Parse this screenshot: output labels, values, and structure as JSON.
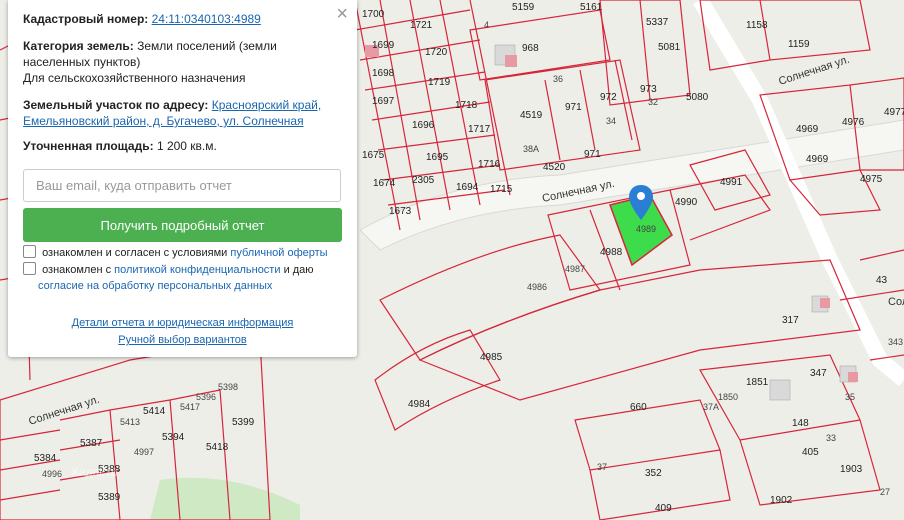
{
  "panel": {
    "close_symbol": "×",
    "cadastral_label": "Кадастровый номер:",
    "cadastral_value": "24:11:0340103:4989",
    "category_label": "Категория земель:",
    "category_value_1": "Земли поселений (земли",
    "category_value_2": "населенных пунктов)",
    "category_value_3": "Для сельскохозяйственного назначения",
    "address_label": "Земельный участок по адресу:",
    "address_value_1": "Красноярский край,",
    "address_value_2": "Емельяновский район, д. Бугачево, ул. Солнечная",
    "area_label": "Уточненная площадь:",
    "area_value": "1 200 кв.м.",
    "email_placeholder": "Ваш email, куда отправить отчет",
    "submit_label": "Получить подробный отчет",
    "consent1_text": "ознакомлен и согласен с условиями",
    "consent1_link": "публичной оферты",
    "consent2_text": "ознакомлен с",
    "consent2_link": "политикой конфиденциальности",
    "consent2_text2": "и даю",
    "consent2_link2": "согласие на обработку персональных данных",
    "details_link": "Детали отчета и юридическая информация",
    "manual_link": "Ручной выбор вариантов"
  },
  "map": {
    "streets": [
      "Солнечная ул.",
      "Солнечная ул.",
      "Солнечная ул.",
      "Солнечная ул."
    ],
    "selected_parcel": "4989",
    "parcels": [
      "1700",
      "1721",
      "1699",
      "1720",
      "1698",
      "1719",
      "1697",
      "1718",
      "1696",
      "1717",
      "1695",
      "1716",
      "1694",
      "1715",
      "1675",
      "1674",
      "1673",
      "2305",
      "4",
      "5159",
      "5161",
      "968",
      "5337",
      "5081",
      "1158",
      "1159",
      "36",
      "32",
      "34",
      "4519",
      "971",
      "972",
      "973",
      "5080",
      "4520",
      "38A",
      "971",
      "4991",
      "4990",
      "4988",
      "4987",
      "4986",
      "4985",
      "4984",
      "4969",
      "4976",
      "4977",
      "4969",
      "4975",
      "43",
      "317",
      "5399",
      "5398",
      "5396",
      "5417",
      "5394",
      "5418",
      "5414",
      "5387",
      "5384",
      "4996",
      "5413",
      "4997",
      "5388",
      "5389",
      "660",
      "37A",
      "1850",
      "1851",
      "37",
      "35",
      "347",
      "148",
      "33",
      "405",
      "1903",
      "352",
      "409",
      "1902",
      "27",
      "343"
    ],
    "watermark": "Кадастр"
  },
  "colors": {
    "parcel_border": "#d6263a",
    "selected_fill": "#3ddc4a",
    "marker": "#2a7fd4",
    "button": "#4caf50",
    "link": "#1a66b0"
  }
}
